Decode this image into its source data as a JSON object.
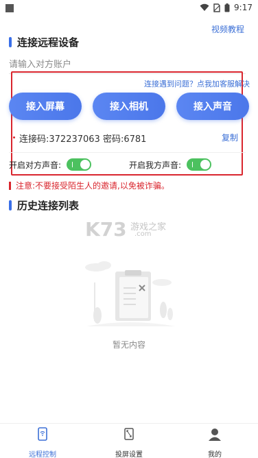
{
  "status_bar": {
    "time": "9:17"
  },
  "header": {
    "video_tutorial": "视频教程"
  },
  "connect_section": {
    "title": "连接远程设备",
    "account_placeholder": "请输入对方账户",
    "service_link": "连接遇到问题？点我加客服解决",
    "buttons": [
      {
        "label": "接入屏幕"
      },
      {
        "label": "接入相机"
      },
      {
        "label": "接入声音"
      }
    ],
    "connection_info": "连接码:372237063 密码:6781",
    "copy_label": "复制",
    "toggles": [
      {
        "label": "开启对方声音:",
        "on": true
      },
      {
        "label": "开启我方声音:",
        "on": true
      }
    ],
    "warning": "注意:不要接受陌生人的邀请,以免被诈骗。",
    "colors": {
      "accent": "#4b77ea",
      "frame": "#d9252d",
      "toggle_on": "#4cc15f"
    }
  },
  "history_section": {
    "title": "历史连接列表",
    "empty_text": "暂无内容"
  },
  "watermark": {
    "brand": "K73",
    "cn": "游戏之家",
    "domain": ".com"
  },
  "bottom_nav": {
    "items": [
      {
        "label": "远程控制",
        "icon": "remote-control-icon",
        "active": true
      },
      {
        "label": "投屏设置",
        "icon": "screen-cast-icon",
        "active": false
      },
      {
        "label": "我的",
        "icon": "profile-icon",
        "active": false
      }
    ]
  }
}
